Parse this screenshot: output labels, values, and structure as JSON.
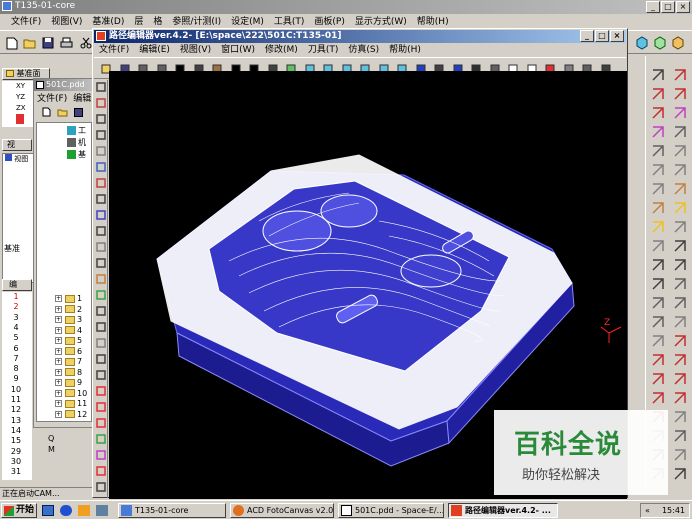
{
  "main_window": {
    "title": "T135-01-core",
    "menu": [
      "文件(F)",
      "视图(V)",
      "基准(D)",
      "层",
      "格",
      "参照/计测(I)",
      "设定(M)",
      "工具(T)",
      "画板(P)",
      "显示方式(W)",
      "帮助(H)"
    ]
  },
  "inner_window": {
    "title": "路径编辑器ver.4.2- [E:\\space\\222\\501C:T135-01]",
    "menu": [
      "文件(F)",
      "编辑(E)",
      "视图(V)",
      "窗口(W)",
      "修改(M)",
      "刀具(T)",
      "仿真(S)",
      "帮助(H)"
    ]
  },
  "left_panel": {
    "header": "基准面",
    "axes": [
      "XY",
      "YZ",
      "ZX"
    ],
    "sub_window_title": "501C.pdd",
    "sub_menu": [
      "文件(F)",
      "编辑"
    ],
    "tab_view": "视",
    "tab_ref": "基准",
    "section2": "编",
    "tree_items": [
      "工",
      "机",
      "基"
    ],
    "tree_numbers": [
      "1",
      "2",
      "3",
      "4",
      "5",
      "6",
      "7",
      "8",
      "9",
      "10",
      "11",
      "12"
    ],
    "row_numbers": [
      "1",
      "2",
      "3",
      "4",
      "5",
      "6",
      "7",
      "8",
      "9",
      "10",
      "11",
      "12",
      "13",
      "14",
      "15",
      "29",
      "30",
      "31"
    ],
    "row_letters": [
      "Q",
      "M"
    ]
  },
  "viewport": {
    "background": "#000000",
    "axis_label": "Z"
  },
  "watermark": {
    "title": "百科全说",
    "subtitle": "助你轻松解决"
  },
  "status": {
    "left_text": "正在启动CAM..."
  },
  "taskbar": {
    "start": "开始",
    "tasks": [
      "T135-01-core",
      "ACD FotoCanvas v2.0",
      "501C.pdd - Space-E/...",
      "路径编辑器ver.4.2- ..."
    ],
    "time": "15:41",
    "lang_indicator": "«"
  },
  "colors": {
    "title_active": "#0a246a",
    "viewport_bg": "#000000",
    "model_blue": "#3030c8",
    "toolpath_white": "#ffffff",
    "watermark_green": "#2a8a3a"
  }
}
